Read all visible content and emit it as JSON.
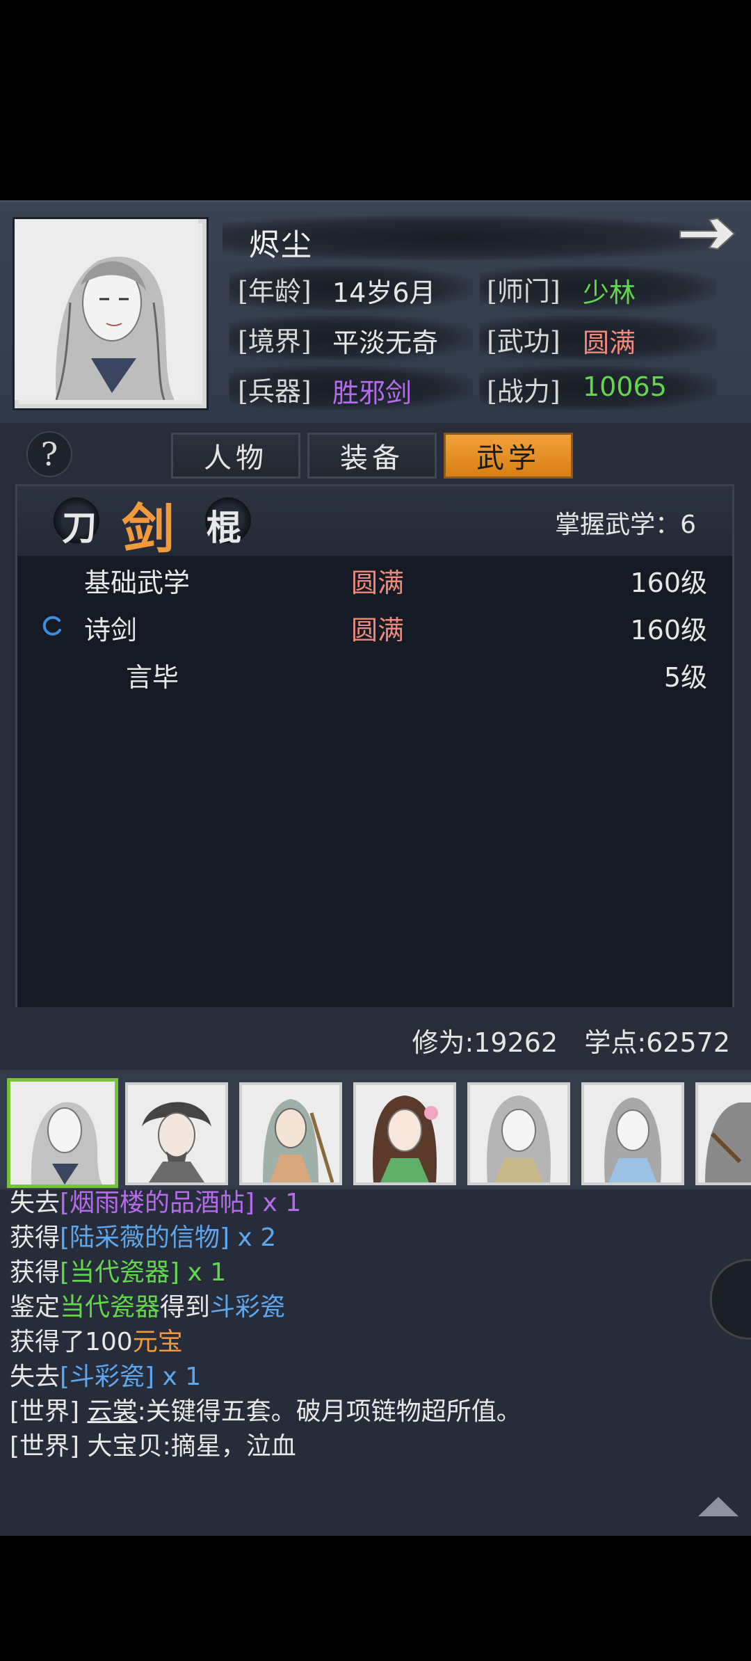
{
  "profile": {
    "name": "烬尘",
    "age_label": "[年龄]",
    "age_value": "14岁6月",
    "sect_label": "[师门]",
    "sect_value": "少林",
    "realm_label": "[境界]",
    "realm_value": "平淡无奇",
    "martial_label": "[武功]",
    "martial_value": "圆满",
    "weapon_label": "[兵器]",
    "weapon_value": "胜邪剑",
    "power_label": "[战力]",
    "power_value": "10065"
  },
  "help_label": "?",
  "tabs": [
    {
      "label": "人物",
      "active": false
    },
    {
      "label": "装备",
      "active": false
    },
    {
      "label": "武学",
      "active": true
    }
  ],
  "weapon_categories": [
    "刀",
    "剑",
    "棍"
  ],
  "selected_category": "剑",
  "mastered_label": "掌握武学：6",
  "skills": [
    {
      "name": "基础武学",
      "status": "圆满",
      "level": "160级"
    },
    {
      "name": "诗剑",
      "status": "圆满",
      "level": "160级",
      "active": true
    },
    {
      "name": "言毕",
      "status": "",
      "level": "5级"
    }
  ],
  "stats": {
    "cultivation": "修为:19262",
    "points": "学点:62572"
  },
  "characters": [
    "char-1",
    "char-2",
    "char-3",
    "char-4",
    "char-5",
    "char-6",
    "char-7"
  ],
  "log": [
    {
      "parts": [
        {
          "t": "失去",
          "c": ""
        },
        {
          "t": "[烟雨楼的品酒帖]",
          "c": "purple"
        },
        {
          "t": " x 1",
          "c": "purple"
        }
      ]
    },
    {
      "parts": [
        {
          "t": "获得",
          "c": ""
        },
        {
          "t": "[陆采薇的信物]",
          "c": "blue"
        },
        {
          "t": " x 2",
          "c": "blue"
        }
      ]
    },
    {
      "parts": [
        {
          "t": "获得",
          "c": ""
        },
        {
          "t": "[当代瓷器]",
          "c": "green"
        },
        {
          "t": " x 1",
          "c": "green"
        }
      ]
    },
    {
      "parts": [
        {
          "t": "鉴定",
          "c": ""
        },
        {
          "t": "当代瓷器",
          "c": "green"
        },
        {
          "t": "得到",
          "c": ""
        },
        {
          "t": "斗彩瓷",
          "c": "blue"
        }
      ]
    },
    {
      "parts": [
        {
          "t": "获得了100",
          "c": ""
        },
        {
          "t": "元宝",
          "c": "orange"
        }
      ]
    },
    {
      "parts": [
        {
          "t": "失去",
          "c": ""
        },
        {
          "t": "[斗彩瓷]",
          "c": "blue"
        },
        {
          "t": " x 1",
          "c": "blue"
        }
      ]
    },
    {
      "parts": [
        {
          "t": "[世界] ",
          "c": ""
        },
        {
          "t": "云裳",
          "c": "underline"
        },
        {
          "t": ":关键得五套。破月项链物超所值。",
          "c": ""
        }
      ]
    },
    {
      "parts": [
        {
          "t": "[世界] ",
          "c": ""
        },
        {
          "t": "大宝贝",
          "c": ""
        },
        {
          "t": ":摘星，泣血",
          "c": ""
        }
      ]
    }
  ],
  "colors": {
    "accent_orange": "#f19a3b",
    "green": "#63d64d",
    "purple": "#b56bea",
    "red": "#f08a7c",
    "blue": "#5fa7ec"
  }
}
